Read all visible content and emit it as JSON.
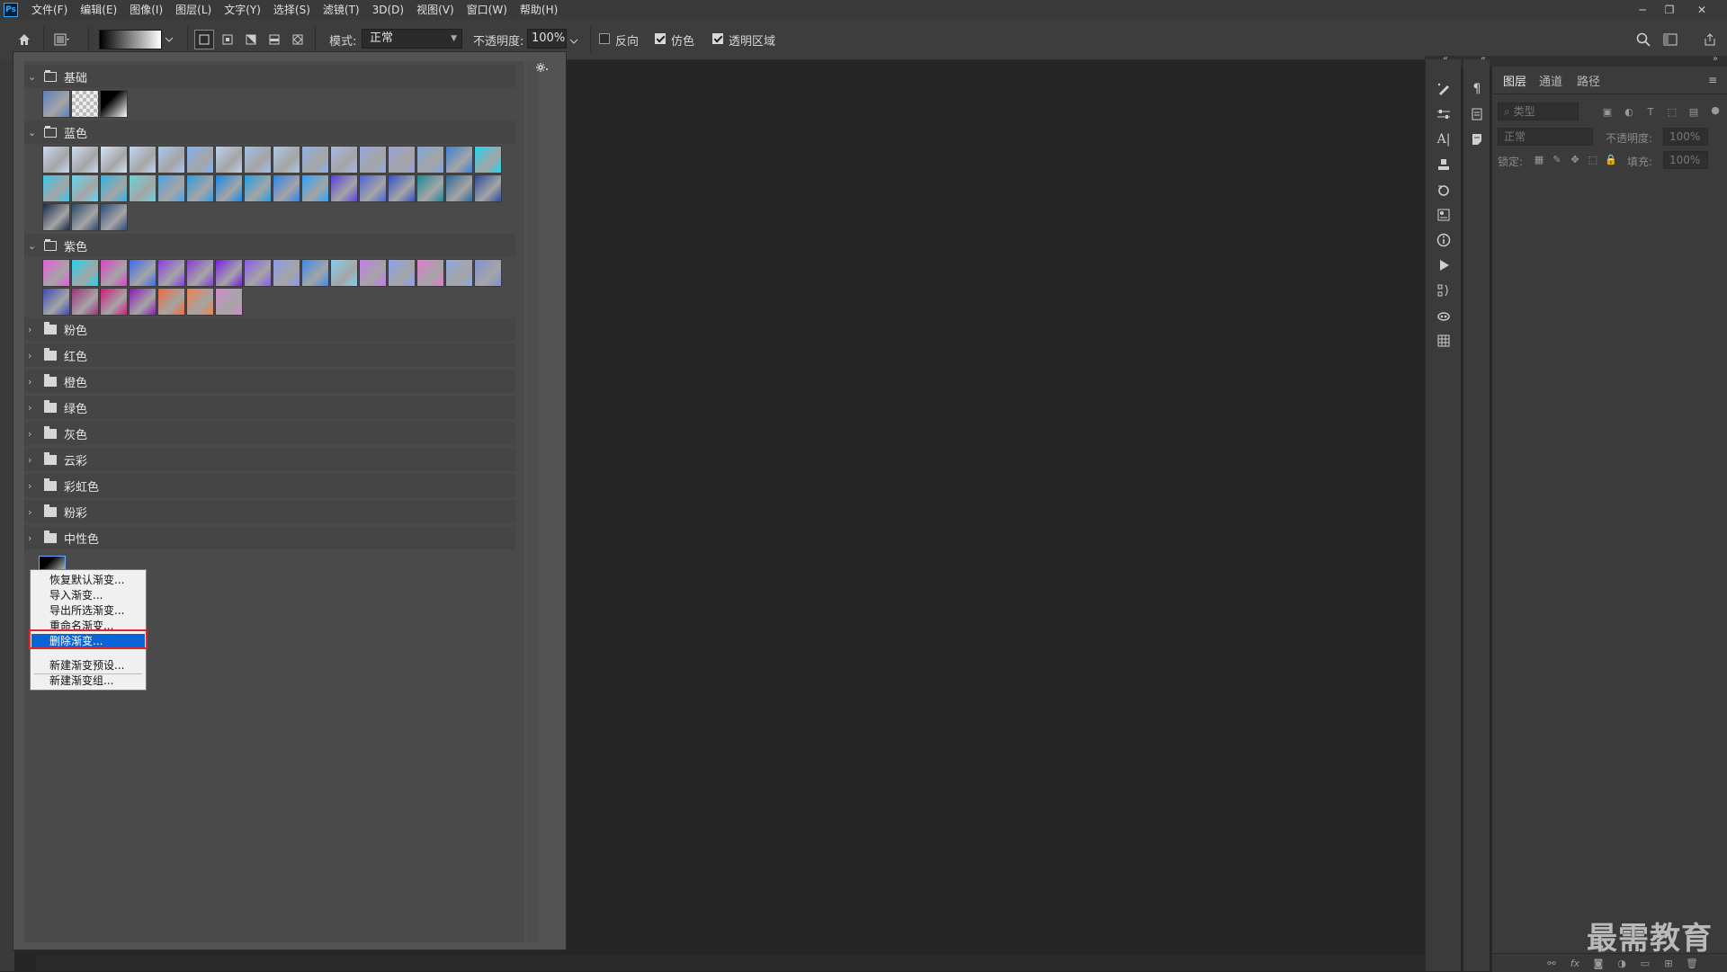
{
  "menu": [
    "文件(F)",
    "编辑(E)",
    "图像(I)",
    "图层(L)",
    "文字(Y)",
    "选择(S)",
    "滤镜(T)",
    "3D(D)",
    "视图(V)",
    "窗口(W)",
    "帮助(H)"
  ],
  "app_logo": "Ps",
  "options": {
    "mode_label": "模式:",
    "mode_value": "正常",
    "opacity_label": "不透明度:",
    "opacity_value": "100%",
    "reverse_label": "反向",
    "dither_label": "仿色",
    "transparency_label": "透明区域",
    "reverse_checked": false,
    "dither_checked": true,
    "transparency_checked": true
  },
  "gradient_groups": {
    "basic": "基础",
    "blue": "蓝色",
    "purple": "紫色",
    "pink": "粉色",
    "red": "红色",
    "orange": "橙色",
    "green": "绿色",
    "gray": "灰色",
    "cloud": "云彩",
    "rainbow": "彩虹色",
    "pastel": "粉彩",
    "neutral": "中性色"
  },
  "swatches": {
    "basic": [
      "#5a7fbf",
      "#cfcfcf",
      "#111111"
    ],
    "blue_row1": [
      "#c9d8f2",
      "#cbdcf3",
      "#d3e4f7",
      "#bfd6f5",
      "#a9c8f2",
      "#7fb3f2",
      "#bcd0f0",
      "#9fc0ea",
      "#aac8e6",
      "#8fb0e8",
      "#a7b6e6",
      "#94a8e0",
      "#9aa0d8",
      "#7ea6dc",
      "#3c7fd8",
      "#1fd5f0"
    ],
    "blue_row2": [
      "#36c8ee",
      "#62d6f3",
      "#2fb4e6",
      "#6ad2d8",
      "#4aa3e8",
      "#2c9ce6",
      "#1288f0",
      "#1da0e8",
      "#2b83f0",
      "#2aa4ff",
      "#5a3fe0",
      "#4c64d8",
      "#3450c8",
      "#1a8a9a",
      "#2c6a9a",
      "#2a4a9a"
    ],
    "blue_row3": [
      "#1a2a4a",
      "#2a4a6a",
      "#2a4a7a"
    ],
    "purple_row1": [
      "#e85adf",
      "#1fd5f0",
      "#e042c8",
      "#3a6af0",
      "#8a3ae8",
      "#8a3ad8",
      "#7a1ee8",
      "#8a5af0",
      "#8a9aee",
      "#3a8af0",
      "#7fd0f0",
      "#c47af0",
      "#8aa0f0",
      "#e07ad0",
      "#8aa8e0",
      "#8090d8"
    ],
    "purple_row2": [
      "#3a4ab8",
      "#a0307a",
      "#d01a7a",
      "#8a1ab8",
      "#f06a3a",
      "#f0804a",
      "#d08acc"
    ]
  },
  "context_menu": {
    "items": [
      "恢复默认渐变...",
      "导入渐变...",
      "导出所选渐变...",
      "重命名渐变...",
      "删除渐变...",
      "新建渐变预设...",
      "新建渐变组..."
    ],
    "selected_index": 4
  },
  "layers_panel": {
    "tabs": [
      "图层",
      "通道",
      "路径"
    ],
    "active_tab": 0,
    "filter_placeholder": "类型",
    "blend_mode": "正常",
    "opacity_label": "不透明度:",
    "opacity_value": "100%",
    "lock_label": "锁定:",
    "fill_label": "填充:",
    "fill_value": "100%"
  },
  "watermark": "最需教育"
}
